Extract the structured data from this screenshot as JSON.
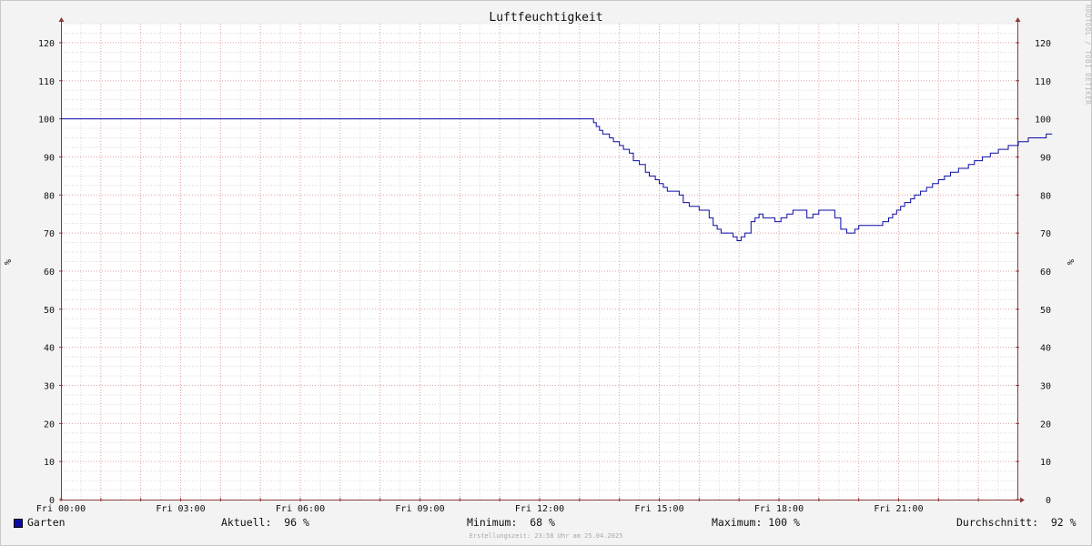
{
  "chart_data": {
    "type": "line",
    "title": "Luftfeuchtigkeit",
    "ylabel": "%",
    "ylabel_right": "%",
    "ylim": [
      0,
      125
    ],
    "yticks": [
      0,
      10,
      20,
      30,
      40,
      50,
      60,
      70,
      80,
      90,
      100,
      110,
      120
    ],
    "x_range_hours": [
      0,
      24
    ],
    "xticks": [
      {
        "hour": 0,
        "label": "Fri 00:00"
      },
      {
        "hour": 3,
        "label": "Fri 03:00"
      },
      {
        "hour": 6,
        "label": "Fri 06:00"
      },
      {
        "hour": 9,
        "label": "Fri 09:00"
      },
      {
        "hour": 12,
        "label": "Fri 12:00"
      },
      {
        "hour": 15,
        "label": "Fri 15:00"
      },
      {
        "hour": 18,
        "label": "Fri 18:00"
      },
      {
        "hour": 21,
        "label": "Fri 21:00"
      }
    ],
    "grid": true,
    "series": [
      {
        "name": "Garten",
        "color": "#0a0aa6",
        "points": [
          [
            0,
            100
          ],
          [
            13.25,
            100
          ],
          [
            13.35,
            99
          ],
          [
            13.42,
            98
          ],
          [
            13.5,
            97
          ],
          [
            13.58,
            96
          ],
          [
            13.75,
            95
          ],
          [
            13.85,
            94
          ],
          [
            14.0,
            93
          ],
          [
            14.1,
            92
          ],
          [
            14.25,
            91
          ],
          [
            14.35,
            89
          ],
          [
            14.5,
            88
          ],
          [
            14.65,
            86
          ],
          [
            14.75,
            85
          ],
          [
            14.9,
            84
          ],
          [
            15.0,
            83
          ],
          [
            15.1,
            82
          ],
          [
            15.2,
            81
          ],
          [
            15.5,
            80
          ],
          [
            15.6,
            78
          ],
          [
            15.75,
            77
          ],
          [
            15.9,
            77
          ],
          [
            16.0,
            76
          ],
          [
            16.15,
            76
          ],
          [
            16.25,
            74
          ],
          [
            16.35,
            72
          ],
          [
            16.45,
            71
          ],
          [
            16.55,
            70
          ],
          [
            16.75,
            70
          ],
          [
            16.85,
            69
          ],
          [
            16.95,
            68
          ],
          [
            17.05,
            69
          ],
          [
            17.15,
            70
          ],
          [
            17.3,
            73
          ],
          [
            17.4,
            74
          ],
          [
            17.5,
            75
          ],
          [
            17.6,
            74
          ],
          [
            17.8,
            74
          ],
          [
            17.9,
            73
          ],
          [
            18.05,
            74
          ],
          [
            18.2,
            75
          ],
          [
            18.35,
            76
          ],
          [
            18.6,
            76
          ],
          [
            18.7,
            74
          ],
          [
            18.85,
            75
          ],
          [
            19.0,
            76
          ],
          [
            19.3,
            76
          ],
          [
            19.4,
            74
          ],
          [
            19.55,
            71
          ],
          [
            19.7,
            70
          ],
          [
            19.9,
            71
          ],
          [
            20.0,
            72
          ],
          [
            20.5,
            72
          ],
          [
            20.6,
            73
          ],
          [
            20.75,
            74
          ],
          [
            20.85,
            75
          ],
          [
            20.95,
            76
          ],
          [
            21.05,
            77
          ],
          [
            21.15,
            78
          ],
          [
            21.3,
            79
          ],
          [
            21.4,
            80
          ],
          [
            21.55,
            81
          ],
          [
            21.7,
            82
          ],
          [
            21.85,
            83
          ],
          [
            22.0,
            84
          ],
          [
            22.15,
            85
          ],
          [
            22.3,
            86
          ],
          [
            22.5,
            87
          ],
          [
            22.75,
            88
          ],
          [
            22.9,
            89
          ],
          [
            23.1,
            90
          ],
          [
            23.3,
            91
          ],
          [
            23.5,
            92
          ],
          [
            23.75,
            93
          ],
          [
            24.0,
            94
          ],
          [
            24.25,
            95
          ],
          [
            24.5,
            95
          ],
          [
            24.7,
            96
          ],
          [
            24.85,
            96
          ]
        ]
      }
    ],
    "legend": {
      "name": "Garten",
      "current": "Aktuell:  96 %",
      "minimum": "Minimum:  68 %",
      "maximum": "Maximum: 100 %",
      "average": "Durchschnitt:  92 %"
    }
  },
  "footer": {
    "credit": "Erstellungszeit: 23:58 Uhr am 25.04.2025",
    "watermark": "RRDTOOL / TOBI OETIKER"
  },
  "colors": {
    "background": "#f3f3f3",
    "plot_background": "#ffffff",
    "major_grid": "#e0a0a0",
    "minor_grid": "#d8d8d8",
    "line": "#0a0aa6",
    "axis": "#8b3a3a"
  }
}
